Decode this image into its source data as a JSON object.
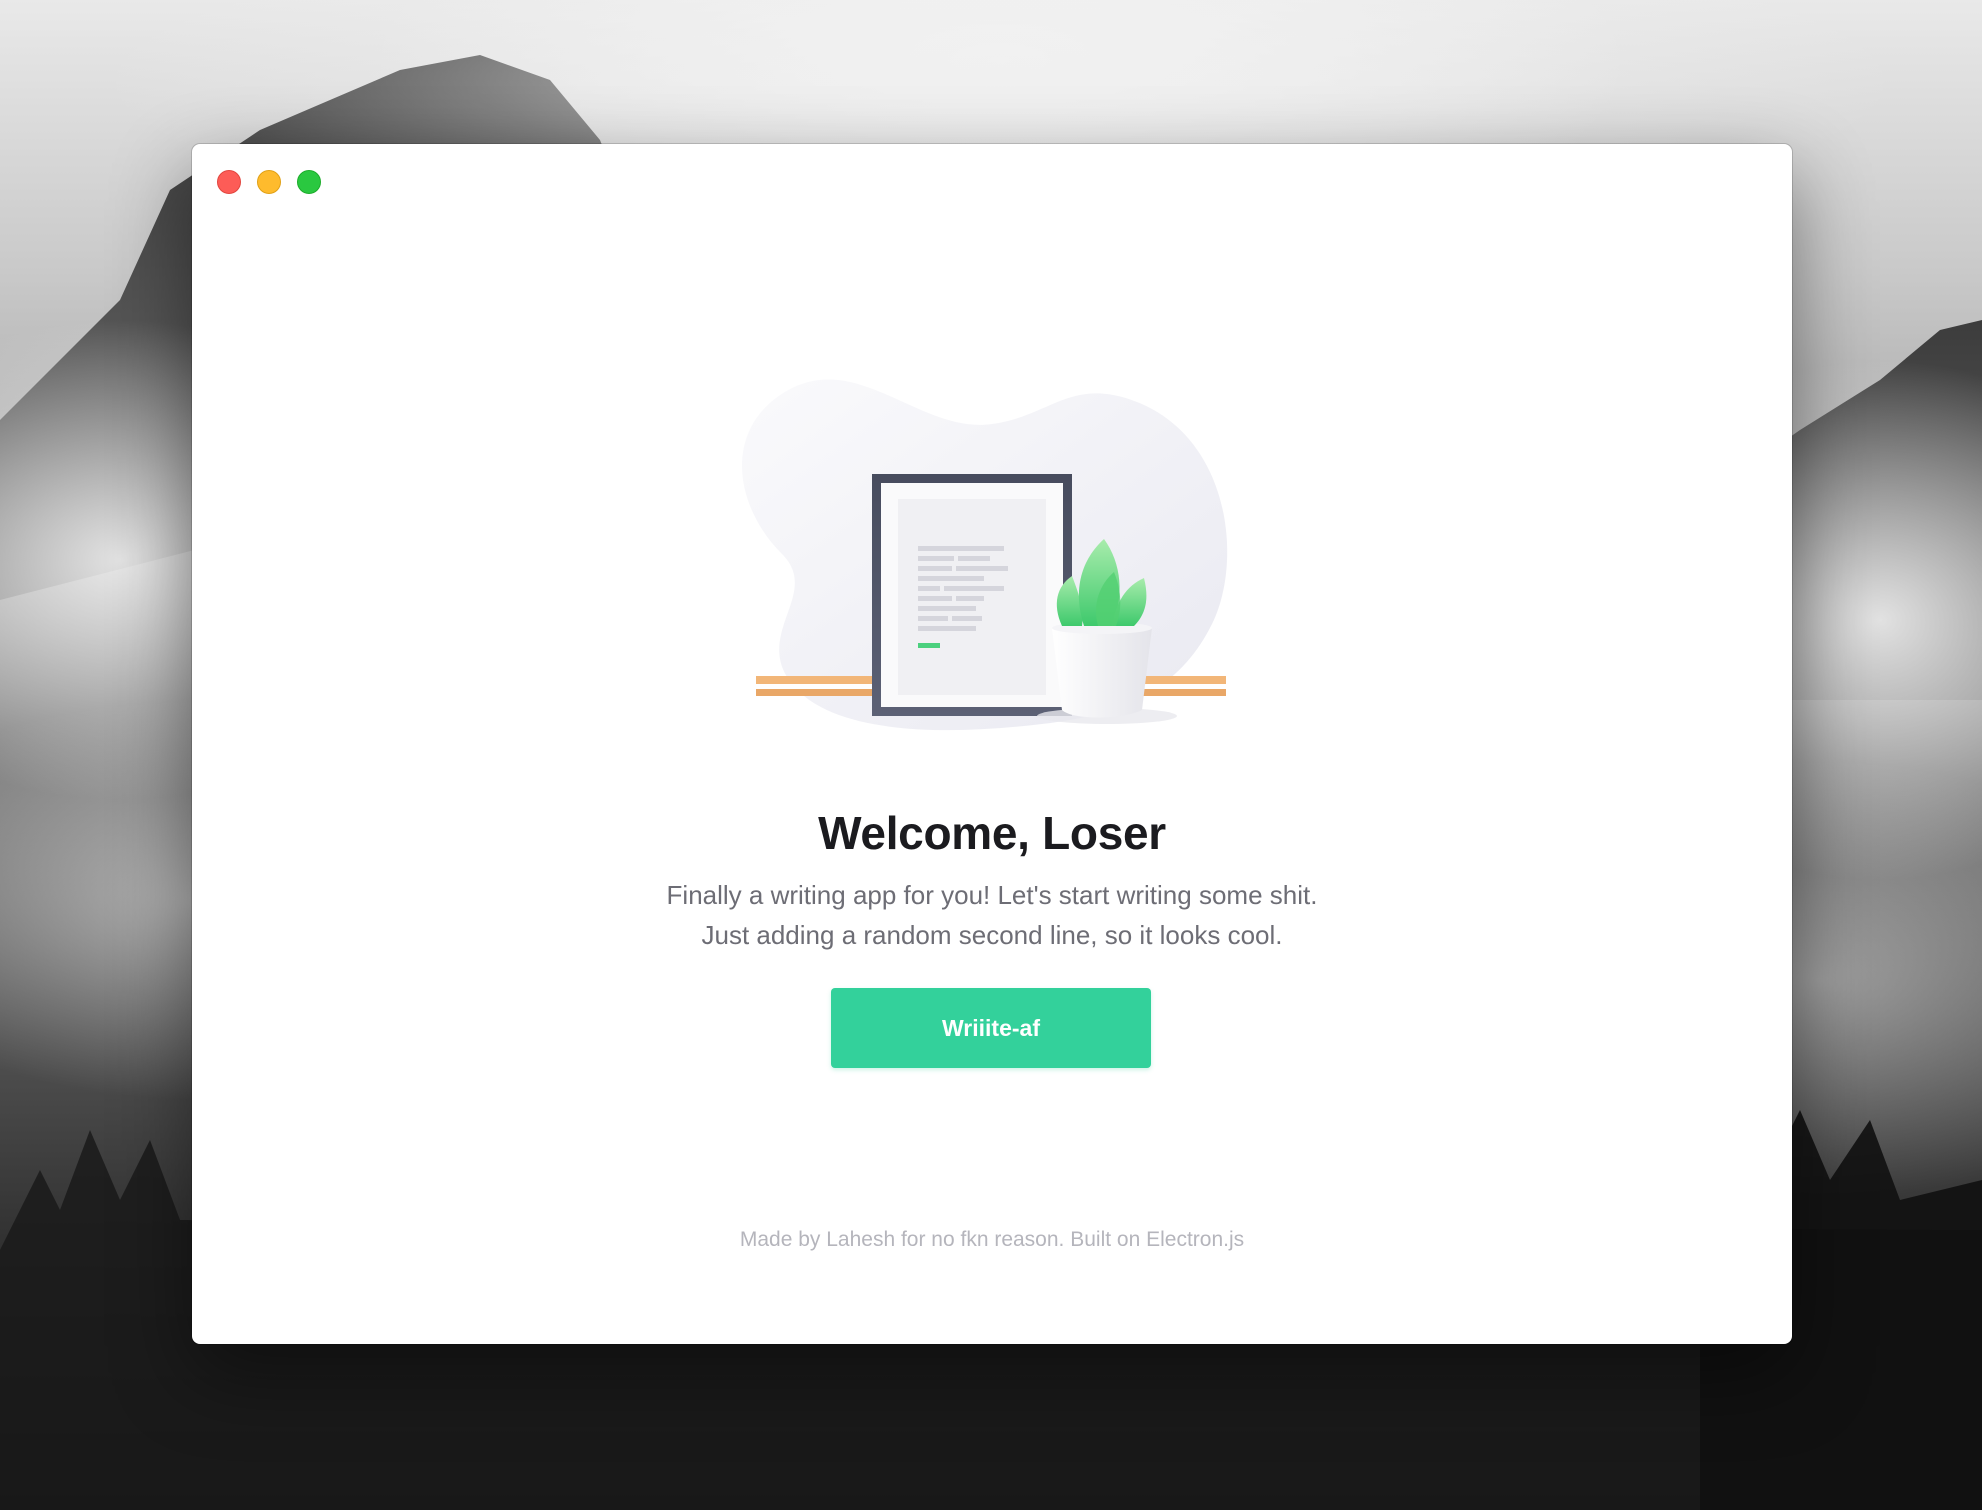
{
  "window": {
    "controls": {
      "close": "close-button",
      "minimize": "minimize-button",
      "maximize": "maximize-button"
    }
  },
  "welcome": {
    "title": "Welcome, Loser",
    "subtitle_line1": "Finally a writing app for you! Let's start writing some shit.",
    "subtitle_line2": "Just adding a random second line, so it looks cool.",
    "cta_label": "Wriiite-af"
  },
  "footer": {
    "text": "Made by Lahesh for no fkn reason. Built on Electron.js"
  },
  "colors": {
    "accent": "#33d19b",
    "close": "#fd5c57",
    "minimize": "#febb2d",
    "maximize": "#2ac840",
    "title": "#1b1b1f",
    "subtitle": "#6d6d75",
    "footer": "#b5b5bc"
  },
  "illustration": {
    "icons": [
      "picture-frame-icon",
      "document-icon",
      "plant-pot-icon",
      "shelf-icon"
    ]
  }
}
